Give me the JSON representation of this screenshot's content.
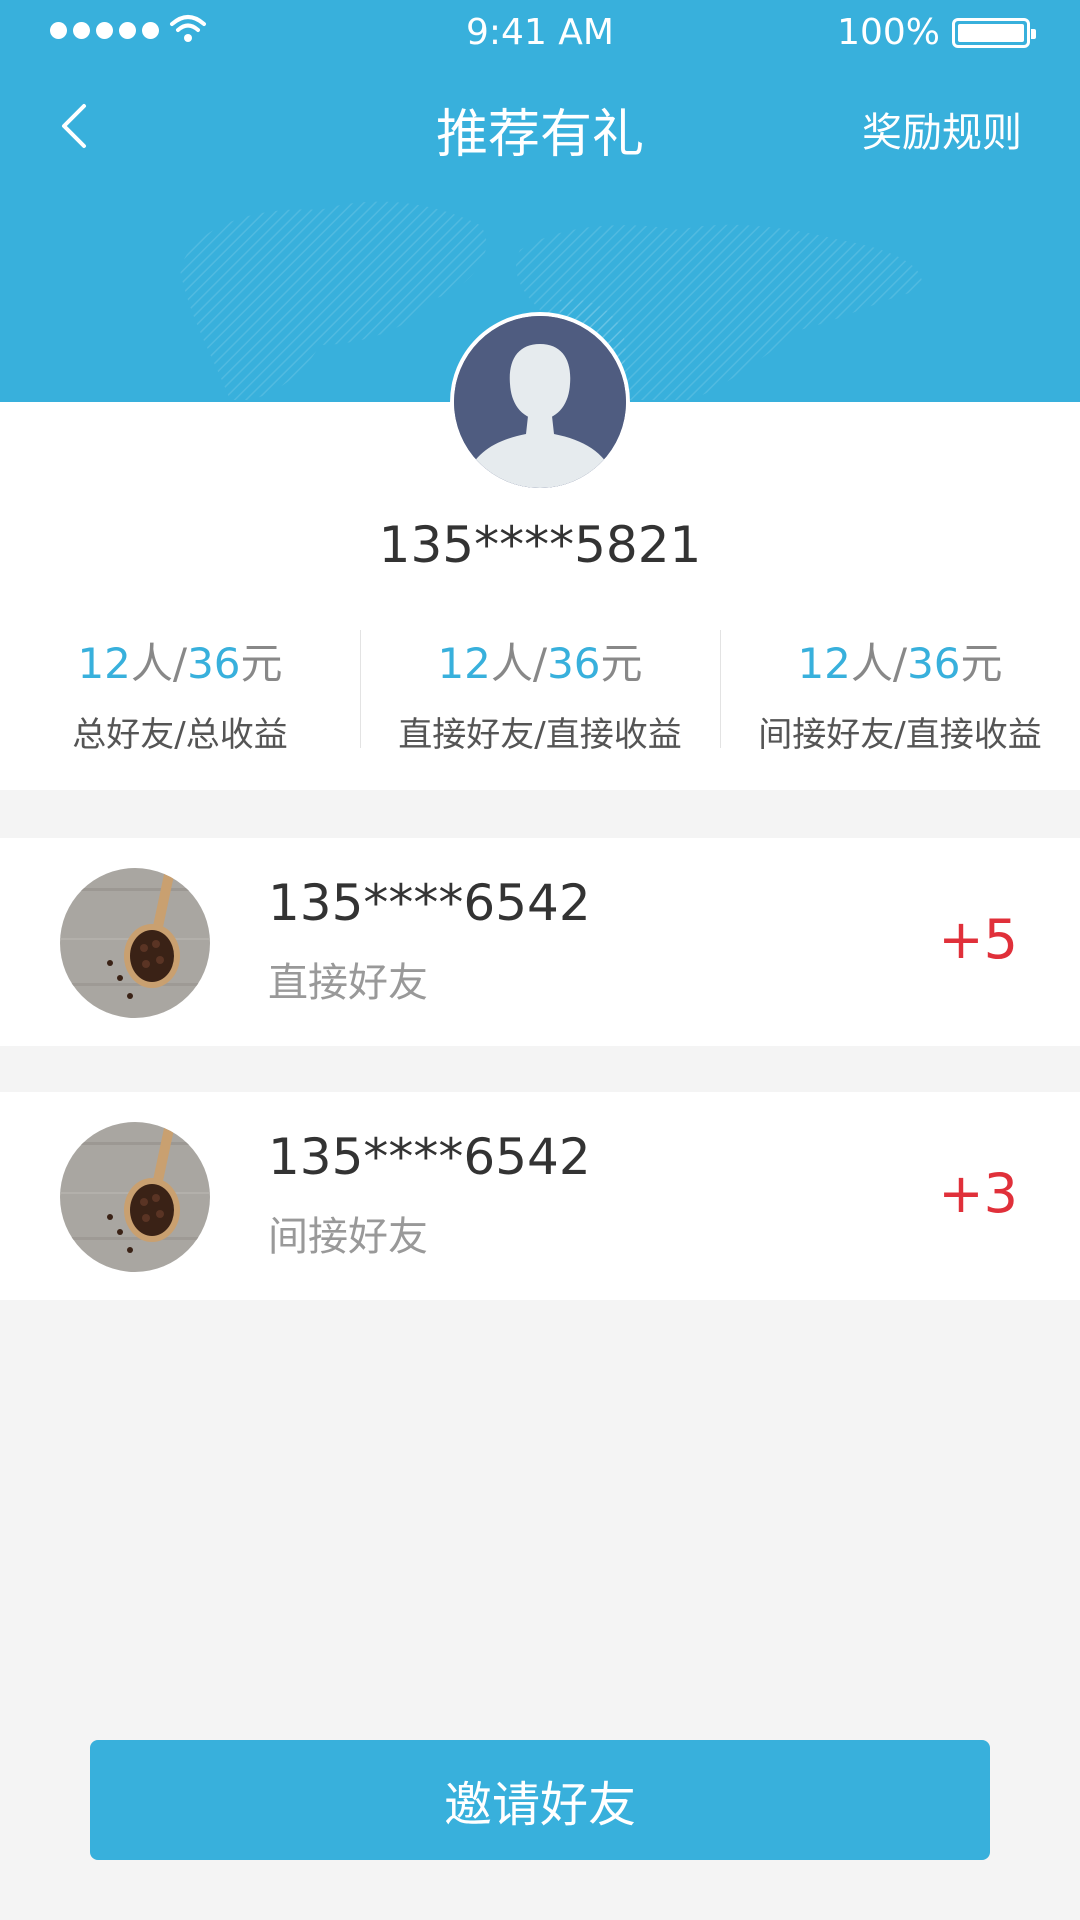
{
  "status_bar": {
    "time": "9:41 AM",
    "battery": "100%",
    "battery_level": 1.0,
    "icons": [
      "signal-dots-icon",
      "wifi-icon",
      "battery-icon"
    ]
  },
  "nav": {
    "title": "推荐有礼",
    "right_link": "奖励规则",
    "back_icon": "chevron-left-icon"
  },
  "profile": {
    "phone": "135****5821",
    "avatar_icon": "user-silhouette-icon"
  },
  "stats": [
    {
      "num1": "12",
      "unit1": "人",
      "sep": "/",
      "num2": "36",
      "unit2": "元",
      "label": "总好友/总收益"
    },
    {
      "num1": "12",
      "unit1": "人",
      "sep": "/",
      "num2": "36",
      "unit2": "元",
      "label": "直接好友/直接收益"
    },
    {
      "num1": "12",
      "unit1": "人",
      "sep": "/",
      "num2": "36",
      "unit2": "元",
      "label": "间接好友/直接收益"
    }
  ],
  "friends": [
    {
      "phone": "135****6542",
      "type": "直接好友",
      "points": "+5"
    },
    {
      "phone": "135****6542",
      "type": "间接好友",
      "points": "+3"
    }
  ],
  "invite_button": "邀请好友",
  "colors": {
    "primary": "#38b0dc",
    "points": "#e0303a",
    "background": "#f4f4f4"
  }
}
